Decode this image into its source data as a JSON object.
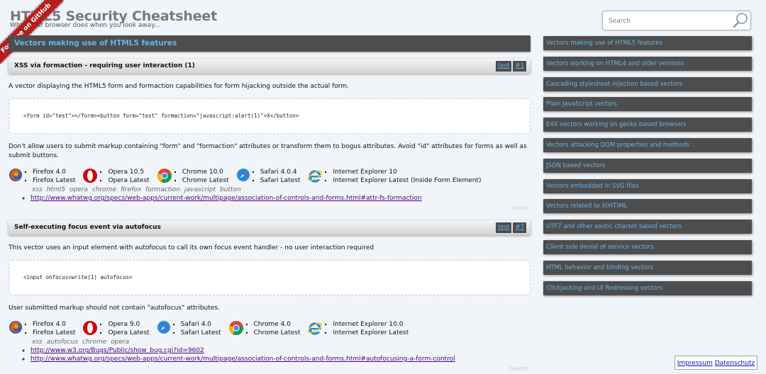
{
  "header": {
    "title": "HTML5 Security Cheatsheet",
    "subtitle": "What your browser does when you look away...",
    "ribbon": "Fork me on GitHub"
  },
  "search": {
    "placeholder": "Search"
  },
  "main": {
    "section_title": "Vectors making use of HTML5 features",
    "vectors": [
      {
        "title": "XSS via formaction - requiring user interaction (1)",
        "badges": [
          "test",
          "#1"
        ],
        "description": "A vector displaying the HTML5 form and formaction capabilities for form hijacking outside the actual form.",
        "code": "<form id=\"test\"></form><button form=\"test\" formaction=\"javascript:alert(1)\">X</button>",
        "advice": "Don't allow users to submit markup containing \"form\" and \"formaction\" attributes or transform them to bogus attributes. Avoid \"id\" attributes for forms as well as submit buttons.",
        "browsers": [
          {
            "icon": "firefox-icon",
            "versions": [
              "Firefox 4.0",
              "Firefox Latest"
            ]
          },
          {
            "icon": "opera-icon",
            "versions": [
              "Opera 10.5",
              "Opera Latest"
            ]
          },
          {
            "icon": "chrome-icon",
            "versions": [
              "Chrome 10.0",
              "Chrome Latest"
            ]
          },
          {
            "icon": "safari-icon",
            "versions": [
              "Safari 4.0.4",
              "Safari Latest"
            ]
          },
          {
            "icon": "ie-icon",
            "versions": [
              "Internet Explorer 10",
              "Internet Explorer Latest (Inside Form Element)"
            ]
          }
        ],
        "tags": [
          "xss",
          "html5",
          "opera",
          "chrome",
          "firefox",
          "formaction",
          "javascript",
          "button"
        ],
        "links": [
          "http://www.whatwg.org/specs/web-apps/current-work/multipage/association-of-controls-and-forms.html#attr-fs-formaction"
        ],
        "author": ".mario"
      },
      {
        "title": "Self-executing focus event via autofocus",
        "badges": [
          "test",
          "#7"
        ],
        "description": "This vector uses an input element with autofocus to call its own focus event handler - no user interaction required",
        "code": "<input onfocus=write(1) autofocus>",
        "advice": "User submitted markup should not contain \"autofocus\" attributes.",
        "browsers": [
          {
            "icon": "firefox-icon",
            "versions": [
              "Firefox 4.0",
              "Firefox Latest"
            ]
          },
          {
            "icon": "opera-icon",
            "versions": [
              "Opera 9.0",
              "Opera Latest"
            ]
          },
          {
            "icon": "safari-icon",
            "versions": [
              "Safari 4.0",
              "Safari Latest"
            ]
          },
          {
            "icon": "chrome-icon",
            "versions": [
              "Chrome 4.0",
              "Chrome Latest"
            ]
          },
          {
            "icon": "ie-icon",
            "versions": [
              "Internet Explorer 10.0",
              "Internet Explorer Latest"
            ]
          }
        ],
        "tags": [
          "xss",
          "autofocus",
          "chrome",
          "opera"
        ],
        "links": [
          "http://www.w3.org/Bugs/Public/show_bug.cgi?id=9602",
          "http://www.whatwg.org/specs/web-apps/current-work/multipage/association-of-controls-and-forms.html#autofocusing-a-form-control"
        ],
        "author": "Gareth"
      }
    ]
  },
  "sidebar": {
    "items": [
      "Vectors making use of HTML5 features",
      "Vectors working on HTML4 and older versions",
      "Cascading stylesheet injection based vectors",
      "Plain JavaScript vectors",
      "E4X vectors working on gecko based browsers",
      "Vectors attacking DOM properties and methods",
      "JSON based vectors",
      "Vectors embedded in SVG files",
      "Vectors related to X(HT)ML",
      "UTF7 and other exotic charset based vectors",
      "Client side denial of service vectors",
      "HTML behavior and binding vectors",
      "Clickjacking and UI Redressing vectors"
    ]
  },
  "footer": {
    "impressum": "Impressum",
    "datenschutz": "Datenschutz"
  },
  "colors": {
    "accent": "#69b3e7",
    "dark_bar": "#4d4d4d",
    "ribbon": "#b1201e",
    "link": "#4b0082"
  }
}
